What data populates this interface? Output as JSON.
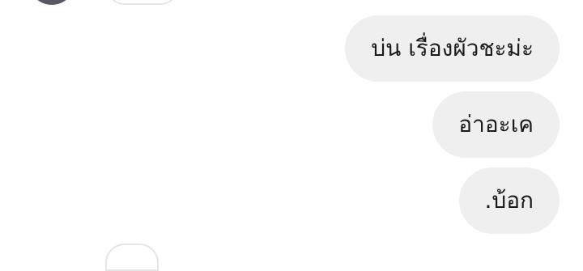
{
  "conversation": {
    "messages": [
      {
        "text": "บ่น เรื่องผัวชะม่ะ",
        "sender": "me"
      },
      {
        "text": "อ่าอะเค",
        "sender": "me"
      },
      {
        "text": ".บ้อก",
        "sender": "me"
      }
    ]
  },
  "colors": {
    "bubble_background": "#efefef",
    "text": "#1a1a1a",
    "avatar": "#5b5661"
  }
}
